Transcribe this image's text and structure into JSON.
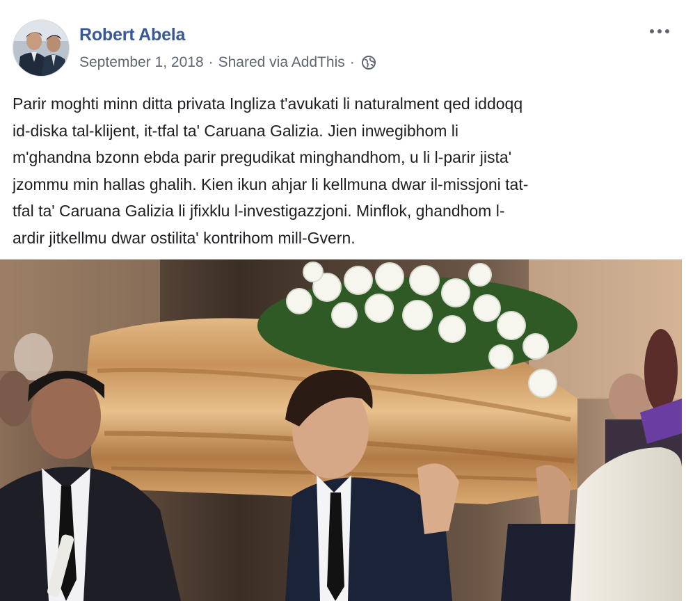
{
  "post": {
    "author": "Robert Abela",
    "date": "September 1, 2018",
    "via": "Shared via AddThis",
    "separator": "·",
    "audience_icon": "globe-icon",
    "menu_icon": "more-options-icon",
    "text_lines": [
      "Parir moghti minn ditta privata Ingliza t'avukati li naturalment qed iddoqq",
      "id-diska tal-klijent, it-tfal ta' Caruana Galizia. Jien inwegibhom li",
      "m'ghandna bzonn ebda parir pregudikat minghandhom, u li l-parir jista'",
      "jzommu min hallas ghalih. Kien ikun ahjar li kellmuna dwar il-missjoni tat-",
      "tfal ta' Caruana Galizia li jfixklu l-investigazzjoni. Minflok, ghandhom l-",
      "ardir jitkellmu dwar ostilita' kontrihom mill-Gvern."
    ]
  },
  "colors": {
    "author_link": "#385898",
    "meta_text": "#606770",
    "body_text": "#1c1e21"
  }
}
